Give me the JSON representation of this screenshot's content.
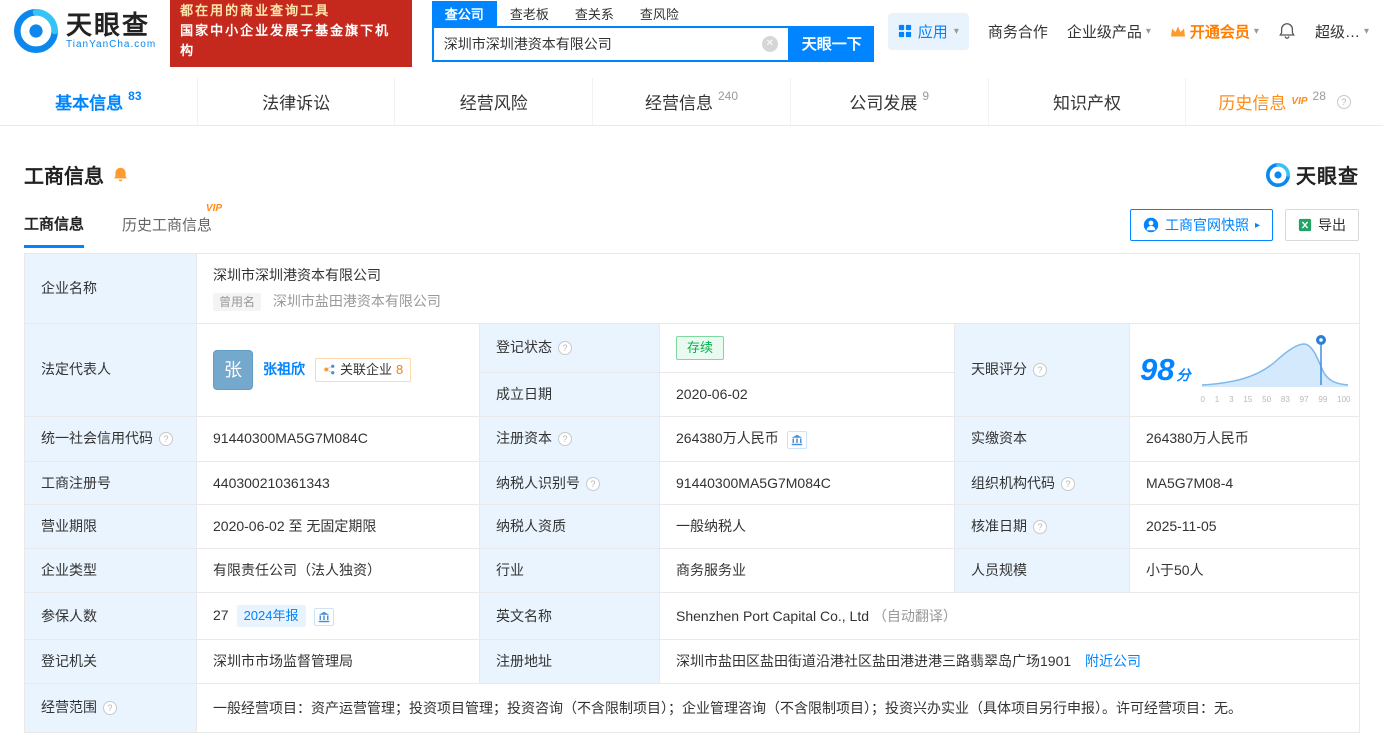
{
  "brand": {
    "name": "天眼查",
    "domain": "TianYanCha.com",
    "promo_line1": "都在用的商业查询工具",
    "promo_line2": "国家中小企业发展子基金旗下机构"
  },
  "icons": {
    "clear": "✕",
    "chevron_down": "▾",
    "arrow_right": "▸",
    "help": "?"
  },
  "search": {
    "tabs": [
      {
        "label": "查公司"
      },
      {
        "label": "查老板"
      },
      {
        "label": "查关系"
      },
      {
        "label": "查风险"
      }
    ],
    "value": "深圳市深圳港资本有限公司",
    "button_label": "天眼一下"
  },
  "topnav": {
    "apps_label": "应用",
    "cooperation": "商务合作",
    "enterprise": "企业级产品",
    "vip": "开通会员",
    "super": "超级…"
  },
  "tabs": [
    {
      "label": "基本信息",
      "count": "83"
    },
    {
      "label": "法律诉讼",
      "count": ""
    },
    {
      "label": "经营风险",
      "count": ""
    },
    {
      "label": "经营信息",
      "count": "240"
    },
    {
      "label": "公司发展",
      "count": "9"
    },
    {
      "label": "知识产权",
      "count": ""
    },
    {
      "label": "历史信息",
      "count": "28",
      "vip": "VIP"
    }
  ],
  "section": {
    "title": "工商信息",
    "subtab_current": "工商信息",
    "subtab_history": "历史工商信息",
    "history_vip": "VIP",
    "snapshot_button": "工商官网快照",
    "export_button": "导出"
  },
  "score": {
    "label": "天眼评分",
    "value": "98",
    "unit": "分",
    "axis": [
      "0",
      "1",
      "3",
      "15",
      "50",
      "83",
      "97",
      "99",
      "100"
    ]
  },
  "fields": {
    "company_name_label": "企业名称",
    "company_name": "深圳市深圳港资本有限公司",
    "former_tag": "曾用名",
    "former_name": "深圳市盐田港资本有限公司",
    "legal_rep_label": "法定代表人",
    "legal_rep_avatar": "张",
    "legal_rep_name": "张祖欣",
    "related_label": "关联企业",
    "related_count": "8",
    "status_label": "登记状态",
    "status_value": "存续",
    "established_label": "成立日期",
    "established_value": "2020-06-02",
    "credit_code_label": "统一社会信用代码",
    "credit_code": "91440300MA5G7M084C",
    "reg_capital_label": "注册资本",
    "reg_capital": "264380万人民币",
    "paid_capital_label": "实缴资本",
    "paid_capital": "264380万人民币",
    "reg_no_label": "工商注册号",
    "reg_no": "440300210361343",
    "taxpayer_no_label": "纳税人识别号",
    "taxpayer_no": "91440300MA5G7M084C",
    "org_code_label": "组织机构代码",
    "org_code": "MA5G7M08-4",
    "term_label": "营业期限",
    "term_value": "2020-06-02 至 无固定期限",
    "taxpayer_quality_label": "纳税人资质",
    "taxpayer_quality": "一般纳税人",
    "approval_label": "核准日期",
    "approval_date": "2025-11-05",
    "type_label": "企业类型",
    "type_value": "有限责任公司（法人独资）",
    "industry_label": "行业",
    "industry": "商务服务业",
    "staff_label": "人员规模",
    "staff_size": "小于50人",
    "insured_label": "参保人数",
    "insured_count": "27",
    "annual_report": "2024年报",
    "en_name_label": "英文名称",
    "en_name": "Shenzhen Port Capital Co., Ltd",
    "en_note": "（自动翻译）",
    "authority_label": "登记机关",
    "authority": "深圳市市场监督管理局",
    "address_label": "注册地址",
    "address": "深圳市盐田区盐田街道沿港社区盐田港进港三路翡翠岛广场1901",
    "nearby": "附近公司",
    "scope_label": "经营范围",
    "scope": "一般经营项目：资产运营管理；投资项目管理；投资咨询（不含限制项目）；企业管理咨询（不含限制项目）；投资兴办实业（具体项目另行申报）。许可经营项目：无。"
  }
}
